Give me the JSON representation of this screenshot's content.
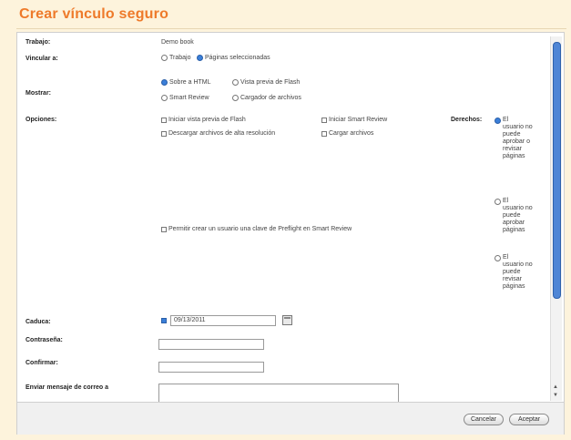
{
  "page": {
    "title": "Crear vínculo seguro"
  },
  "form": {
    "trabajo": {
      "label": "Trabajo:",
      "value": "Demo book"
    },
    "vincular": {
      "label": "Vincular a:",
      "options": [
        {
          "label": "Trabajo",
          "checked": false
        },
        {
          "label": "Páginas seleccionadas",
          "checked": true
        }
      ]
    },
    "mostrar": {
      "label": "Mostrar:",
      "options": [
        {
          "label": "Sobre a HTML",
          "checked": true
        },
        {
          "label": "Vista previa de Flash",
          "checked": false
        },
        {
          "label": "Smart Review",
          "checked": false
        },
        {
          "label": "Cargador de archivos",
          "checked": false
        }
      ]
    },
    "opciones": {
      "label": "Opciones:",
      "options": [
        {
          "label": "Iniciar vista previa de Flash",
          "checked": false
        },
        {
          "label": "Iniciar Smart Review",
          "checked": false
        },
        {
          "label": "Descargar archivos de alta resolución",
          "checked": false
        },
        {
          "label": "Cargar archivos",
          "checked": false
        },
        {
          "label": "Permitir crear un usuario una clave de Preflight en Smart Review",
          "checked": false
        }
      ]
    },
    "derechos": {
      "label": "Derechos:",
      "options": [
        {
          "lines": [
            "El",
            "usuario no",
            "puede",
            "aprobar o",
            "revisar",
            "páginas"
          ],
          "checked": true
        },
        {
          "lines": [
            "El",
            "usuario no",
            "puede",
            "aprobar",
            "páginas"
          ],
          "checked": false
        },
        {
          "lines": [
            "El",
            "usuario no",
            "puede",
            "revisar",
            "páginas"
          ],
          "checked": false
        }
      ]
    },
    "caduca": {
      "label": "Caduca:",
      "checked": true,
      "value": "09/13/2011"
    },
    "contrasena": {
      "label": "Contraseña:",
      "value": ""
    },
    "confirmar": {
      "label": "Confirmar:",
      "value": ""
    },
    "mensaje": {
      "label": "Enviar mensaje de correo a",
      "value": ""
    }
  },
  "footer": {
    "cancel_label": "Cancelar",
    "accept_label": "Aceptar"
  },
  "colors": {
    "title": "#ee7a2a",
    "accent": "#3b7fd9",
    "background": "#fdf3dc"
  }
}
